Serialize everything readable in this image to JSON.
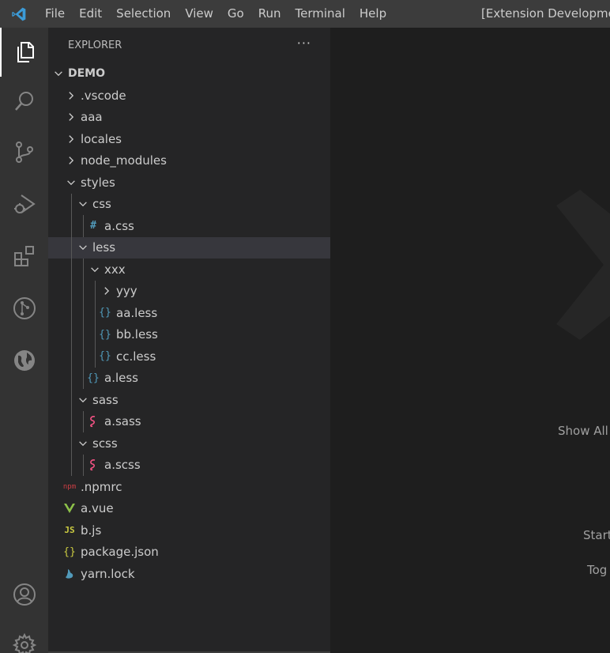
{
  "titlebar": {
    "menu": [
      "File",
      "Edit",
      "Selection",
      "View",
      "Go",
      "Run",
      "Terminal",
      "Help"
    ],
    "window_title": "[Extension Development"
  },
  "activitybar": {
    "items": [
      "explorer-icon",
      "search-icon",
      "source-control-icon",
      "run-debug-icon",
      "extensions-icon",
      "git-graph-icon",
      "remote-explorer-icon"
    ],
    "bottom": [
      "account-icon",
      "settings-gear-icon"
    ]
  },
  "explorer": {
    "header": "EXPLORER",
    "more": "···",
    "section": "DEMO",
    "tree": [
      {
        "label": ".vscode",
        "depth": 0,
        "type": "folder",
        "expanded": false
      },
      {
        "label": "aaa",
        "depth": 0,
        "type": "folder",
        "expanded": false
      },
      {
        "label": "locales",
        "depth": 0,
        "type": "folder",
        "expanded": false
      },
      {
        "label": "node_modules",
        "depth": 0,
        "type": "folder",
        "expanded": false
      },
      {
        "label": "styles",
        "depth": 0,
        "type": "folder",
        "expanded": true
      },
      {
        "label": "css",
        "depth": 1,
        "type": "folder",
        "expanded": true
      },
      {
        "label": "a.css",
        "depth": 2,
        "type": "css"
      },
      {
        "label": "less",
        "depth": 1,
        "type": "folder",
        "expanded": true,
        "selected": true
      },
      {
        "label": "xxx",
        "depth": 2,
        "type": "folder",
        "expanded": true
      },
      {
        "label": "yyy",
        "depth": 3,
        "type": "folder",
        "expanded": false
      },
      {
        "label": "aa.less",
        "depth": 3,
        "type": "less"
      },
      {
        "label": "bb.less",
        "depth": 3,
        "type": "less"
      },
      {
        "label": "cc.less",
        "depth": 3,
        "type": "less"
      },
      {
        "label": "a.less",
        "depth": 2,
        "type": "less"
      },
      {
        "label": "sass",
        "depth": 1,
        "type": "folder",
        "expanded": true
      },
      {
        "label": "a.sass",
        "depth": 2,
        "type": "sass"
      },
      {
        "label": "scss",
        "depth": 1,
        "type": "folder",
        "expanded": true
      },
      {
        "label": "a.scss",
        "depth": 2,
        "type": "sass"
      },
      {
        "label": ".npmrc",
        "depth": 0,
        "type": "npm"
      },
      {
        "label": "a.vue",
        "depth": 0,
        "type": "vue"
      },
      {
        "label": "b.js",
        "depth": 0,
        "type": "js"
      },
      {
        "label": "package.json",
        "depth": 0,
        "type": "json"
      },
      {
        "label": "yarn.lock",
        "depth": 0,
        "type": "yarn"
      }
    ]
  },
  "icon_glyphs": {
    "css": "#",
    "less": "{}",
    "json": "{}",
    "js": "JS",
    "npm": "npm"
  },
  "editor": {
    "hints": [
      "Show All",
      "Start",
      "Tog"
    ]
  },
  "colors": {
    "accent": "#3c9bd7",
    "css_icon": "#519aba",
    "less_icon": "#519aba",
    "sass_icon": "#f55385",
    "json_icon": "#cbcb41",
    "js_icon": "#cbcb41",
    "vue_icon": "#8dc149",
    "npm_icon": "#cc3e44",
    "yarn_icon": "#519aba"
  }
}
